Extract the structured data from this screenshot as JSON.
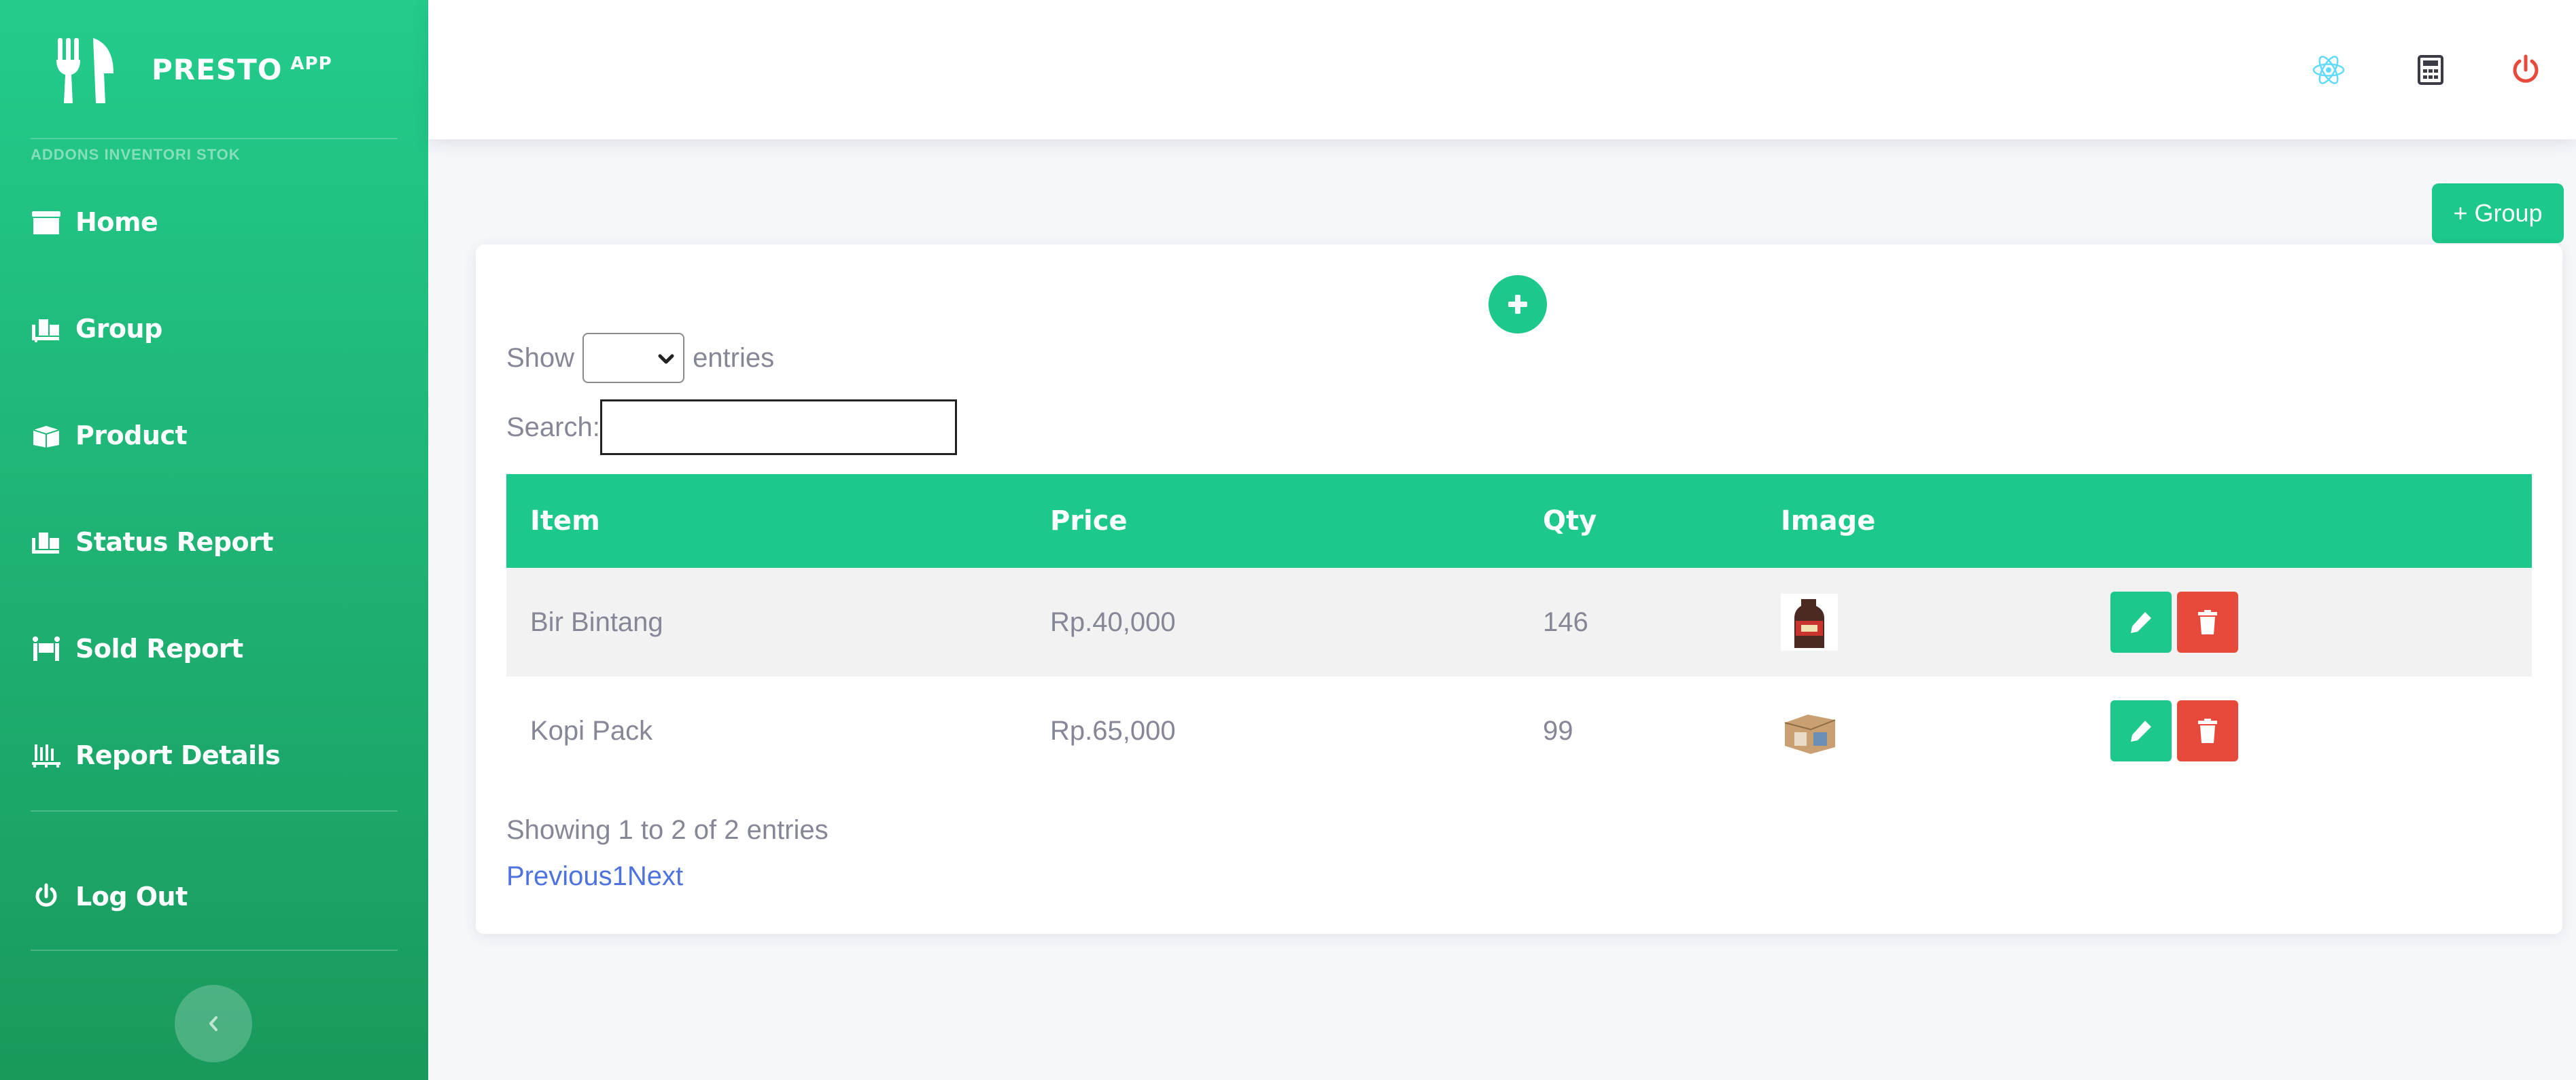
{
  "brand": {
    "name": "PRESTO",
    "sup": "APP"
  },
  "sidebar": {
    "heading": "ADDONS INVENTORI STOK",
    "items": [
      {
        "label": "Home",
        "icon": "store-icon"
      },
      {
        "label": "Group",
        "icon": "dolly-icon"
      },
      {
        "label": "Product",
        "icon": "boxes-icon"
      },
      {
        "label": "Status Report",
        "icon": "dolly-icon"
      },
      {
        "label": "Sold Report",
        "icon": "people-carry-icon"
      },
      {
        "label": "Report Details",
        "icon": "pallet-icon"
      }
    ],
    "logout": "Log Out"
  },
  "topbar": {
    "icons": [
      "react-icon",
      "calculator-icon",
      "power-icon"
    ]
  },
  "actions": {
    "add_group": "+ Group"
  },
  "table_controls": {
    "show": "Show",
    "entries": "entries",
    "search_label": "Search:",
    "search_value": ""
  },
  "table": {
    "columns": [
      "Item",
      "Price",
      "Qty",
      "Image",
      ""
    ],
    "rows": [
      {
        "item": "Bir Bintang",
        "price": "Rp.40,000",
        "qty": "146"
      },
      {
        "item": "Kopi Pack",
        "price": "Rp.65,000",
        "qty": "99"
      }
    ]
  },
  "footer": {
    "info": "Showing 1 to 2 of 2 entries",
    "prev": "Previous",
    "page": "1",
    "next": "Next"
  },
  "colors": {
    "primary": "#1cc88a",
    "danger": "#e74a3b",
    "link": "#4e73df",
    "react": "#61dafb",
    "power": "#e74a3b"
  }
}
